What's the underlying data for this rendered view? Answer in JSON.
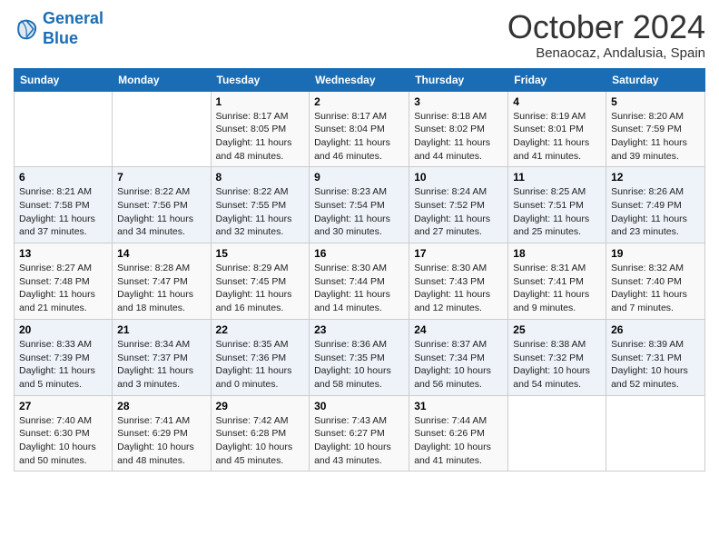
{
  "logo": {
    "line1": "General",
    "line2": "Blue"
  },
  "header": {
    "month": "October 2024",
    "location": "Benaocaz, Andalusia, Spain"
  },
  "columns": [
    "Sunday",
    "Monday",
    "Tuesday",
    "Wednesday",
    "Thursday",
    "Friday",
    "Saturday"
  ],
  "weeks": [
    [
      {
        "day": "",
        "sunrise": "",
        "sunset": "",
        "daylight": ""
      },
      {
        "day": "",
        "sunrise": "",
        "sunset": "",
        "daylight": ""
      },
      {
        "day": "1",
        "sunrise": "Sunrise: 8:17 AM",
        "sunset": "Sunset: 8:05 PM",
        "daylight": "Daylight: 11 hours and 48 minutes."
      },
      {
        "day": "2",
        "sunrise": "Sunrise: 8:17 AM",
        "sunset": "Sunset: 8:04 PM",
        "daylight": "Daylight: 11 hours and 46 minutes."
      },
      {
        "day": "3",
        "sunrise": "Sunrise: 8:18 AM",
        "sunset": "Sunset: 8:02 PM",
        "daylight": "Daylight: 11 hours and 44 minutes."
      },
      {
        "day": "4",
        "sunrise": "Sunrise: 8:19 AM",
        "sunset": "Sunset: 8:01 PM",
        "daylight": "Daylight: 11 hours and 41 minutes."
      },
      {
        "day": "5",
        "sunrise": "Sunrise: 8:20 AM",
        "sunset": "Sunset: 7:59 PM",
        "daylight": "Daylight: 11 hours and 39 minutes."
      }
    ],
    [
      {
        "day": "6",
        "sunrise": "Sunrise: 8:21 AM",
        "sunset": "Sunset: 7:58 PM",
        "daylight": "Daylight: 11 hours and 37 minutes."
      },
      {
        "day": "7",
        "sunrise": "Sunrise: 8:22 AM",
        "sunset": "Sunset: 7:56 PM",
        "daylight": "Daylight: 11 hours and 34 minutes."
      },
      {
        "day": "8",
        "sunrise": "Sunrise: 8:22 AM",
        "sunset": "Sunset: 7:55 PM",
        "daylight": "Daylight: 11 hours and 32 minutes."
      },
      {
        "day": "9",
        "sunrise": "Sunrise: 8:23 AM",
        "sunset": "Sunset: 7:54 PM",
        "daylight": "Daylight: 11 hours and 30 minutes."
      },
      {
        "day": "10",
        "sunrise": "Sunrise: 8:24 AM",
        "sunset": "Sunset: 7:52 PM",
        "daylight": "Daylight: 11 hours and 27 minutes."
      },
      {
        "day": "11",
        "sunrise": "Sunrise: 8:25 AM",
        "sunset": "Sunset: 7:51 PM",
        "daylight": "Daylight: 11 hours and 25 minutes."
      },
      {
        "day": "12",
        "sunrise": "Sunrise: 8:26 AM",
        "sunset": "Sunset: 7:49 PM",
        "daylight": "Daylight: 11 hours and 23 minutes."
      }
    ],
    [
      {
        "day": "13",
        "sunrise": "Sunrise: 8:27 AM",
        "sunset": "Sunset: 7:48 PM",
        "daylight": "Daylight: 11 hours and 21 minutes."
      },
      {
        "day": "14",
        "sunrise": "Sunrise: 8:28 AM",
        "sunset": "Sunset: 7:47 PM",
        "daylight": "Daylight: 11 hours and 18 minutes."
      },
      {
        "day": "15",
        "sunrise": "Sunrise: 8:29 AM",
        "sunset": "Sunset: 7:45 PM",
        "daylight": "Daylight: 11 hours and 16 minutes."
      },
      {
        "day": "16",
        "sunrise": "Sunrise: 8:30 AM",
        "sunset": "Sunset: 7:44 PM",
        "daylight": "Daylight: 11 hours and 14 minutes."
      },
      {
        "day": "17",
        "sunrise": "Sunrise: 8:30 AM",
        "sunset": "Sunset: 7:43 PM",
        "daylight": "Daylight: 11 hours and 12 minutes."
      },
      {
        "day": "18",
        "sunrise": "Sunrise: 8:31 AM",
        "sunset": "Sunset: 7:41 PM",
        "daylight": "Daylight: 11 hours and 9 minutes."
      },
      {
        "day": "19",
        "sunrise": "Sunrise: 8:32 AM",
        "sunset": "Sunset: 7:40 PM",
        "daylight": "Daylight: 11 hours and 7 minutes."
      }
    ],
    [
      {
        "day": "20",
        "sunrise": "Sunrise: 8:33 AM",
        "sunset": "Sunset: 7:39 PM",
        "daylight": "Daylight: 11 hours and 5 minutes."
      },
      {
        "day": "21",
        "sunrise": "Sunrise: 8:34 AM",
        "sunset": "Sunset: 7:37 PM",
        "daylight": "Daylight: 11 hours and 3 minutes."
      },
      {
        "day": "22",
        "sunrise": "Sunrise: 8:35 AM",
        "sunset": "Sunset: 7:36 PM",
        "daylight": "Daylight: 11 hours and 0 minutes."
      },
      {
        "day": "23",
        "sunrise": "Sunrise: 8:36 AM",
        "sunset": "Sunset: 7:35 PM",
        "daylight": "Daylight: 10 hours and 58 minutes."
      },
      {
        "day": "24",
        "sunrise": "Sunrise: 8:37 AM",
        "sunset": "Sunset: 7:34 PM",
        "daylight": "Daylight: 10 hours and 56 minutes."
      },
      {
        "day": "25",
        "sunrise": "Sunrise: 8:38 AM",
        "sunset": "Sunset: 7:32 PM",
        "daylight": "Daylight: 10 hours and 54 minutes."
      },
      {
        "day": "26",
        "sunrise": "Sunrise: 8:39 AM",
        "sunset": "Sunset: 7:31 PM",
        "daylight": "Daylight: 10 hours and 52 minutes."
      }
    ],
    [
      {
        "day": "27",
        "sunrise": "Sunrise: 7:40 AM",
        "sunset": "Sunset: 6:30 PM",
        "daylight": "Daylight: 10 hours and 50 minutes."
      },
      {
        "day": "28",
        "sunrise": "Sunrise: 7:41 AM",
        "sunset": "Sunset: 6:29 PM",
        "daylight": "Daylight: 10 hours and 48 minutes."
      },
      {
        "day": "29",
        "sunrise": "Sunrise: 7:42 AM",
        "sunset": "Sunset: 6:28 PM",
        "daylight": "Daylight: 10 hours and 45 minutes."
      },
      {
        "day": "30",
        "sunrise": "Sunrise: 7:43 AM",
        "sunset": "Sunset: 6:27 PM",
        "daylight": "Daylight: 10 hours and 43 minutes."
      },
      {
        "day": "31",
        "sunrise": "Sunrise: 7:44 AM",
        "sunset": "Sunset: 6:26 PM",
        "daylight": "Daylight: 10 hours and 41 minutes."
      },
      {
        "day": "",
        "sunrise": "",
        "sunset": "",
        "daylight": ""
      },
      {
        "day": "",
        "sunrise": "",
        "sunset": "",
        "daylight": ""
      }
    ]
  ]
}
